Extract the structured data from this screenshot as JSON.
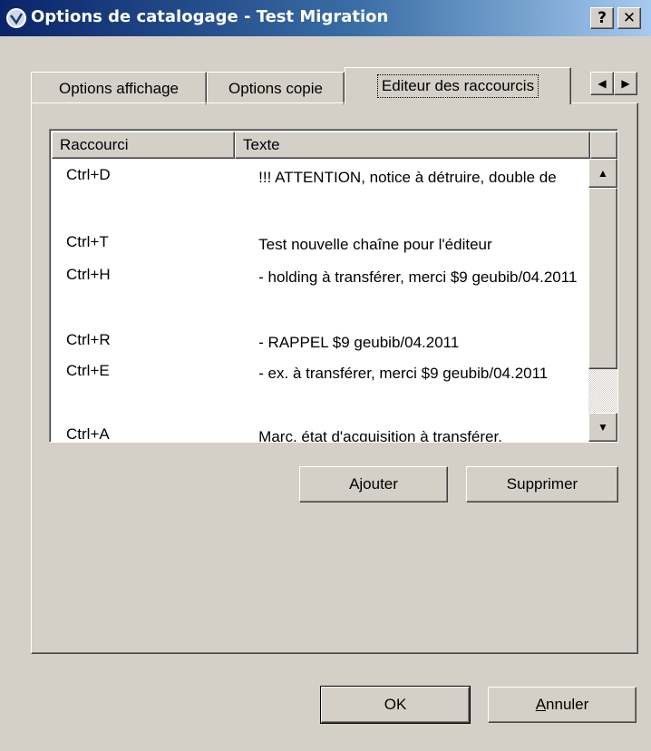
{
  "window": {
    "title": "Options de catalogage - Test Migration",
    "help_label": "?",
    "close_label": "✕"
  },
  "tabs": [
    {
      "label": "Options affichage",
      "active": false
    },
    {
      "label": "Options copie",
      "active": false
    },
    {
      "label": "Editeur des raccourcis",
      "active": true
    }
  ],
  "tab_scroll": {
    "left": "◀",
    "right": "▶"
  },
  "table": {
    "columns": [
      "Raccourci",
      "Texte"
    ],
    "rows": [
      {
        "key": "Ctrl+D",
        "text": "   !!! ATTENTION, notice à détruire, double de"
      },
      {
        "key": "Ctrl+T",
        "text": "   Test nouvelle chaîne pour l'éditeur"
      },
      {
        "key": "Ctrl+H",
        "text": "   - holding à transférer, merci $9 geubib/04.2011"
      },
      {
        "key": "Ctrl+R",
        "text": "   - RAPPEL $9 geubib/04.2011"
      },
      {
        "key": "Ctrl+E",
        "text": "   - ex. à transférer, merci $9 geubib/04.2011"
      },
      {
        "key": "Ctrl+A",
        "text": "   Marc, état d'acquisition à transférer,"
      }
    ]
  },
  "scrollbar": {
    "up": "▲",
    "down": "▼"
  },
  "buttons": {
    "add": "Ajouter",
    "delete": "Supprimer",
    "ok": "OK",
    "cancel_mnemonic": "A",
    "cancel_rest": "nnuler"
  }
}
